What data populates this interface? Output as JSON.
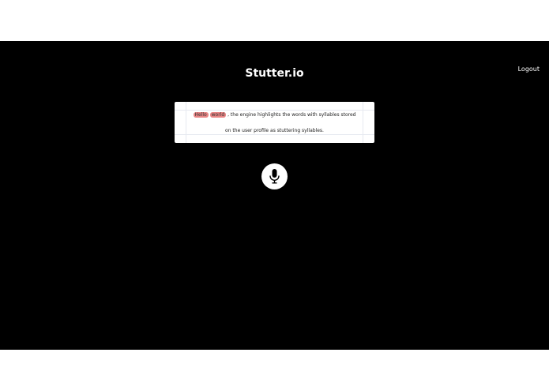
{
  "header": {
    "app_title": "Stutter.io",
    "logout_label": "Logout"
  },
  "transcript": {
    "highlighted_words": [
      "Hello",
      "world"
    ],
    "line1_rest": ", the engine highlights the words with syllables stored",
    "line2": "on the user profile as stuttering syllables.",
    "highlight_color": "#e88585"
  },
  "controls": {
    "mic_icon": "microphone-icon"
  },
  "colors": {
    "background": "#000000",
    "card": "#ffffff",
    "text": "#ffffff"
  }
}
